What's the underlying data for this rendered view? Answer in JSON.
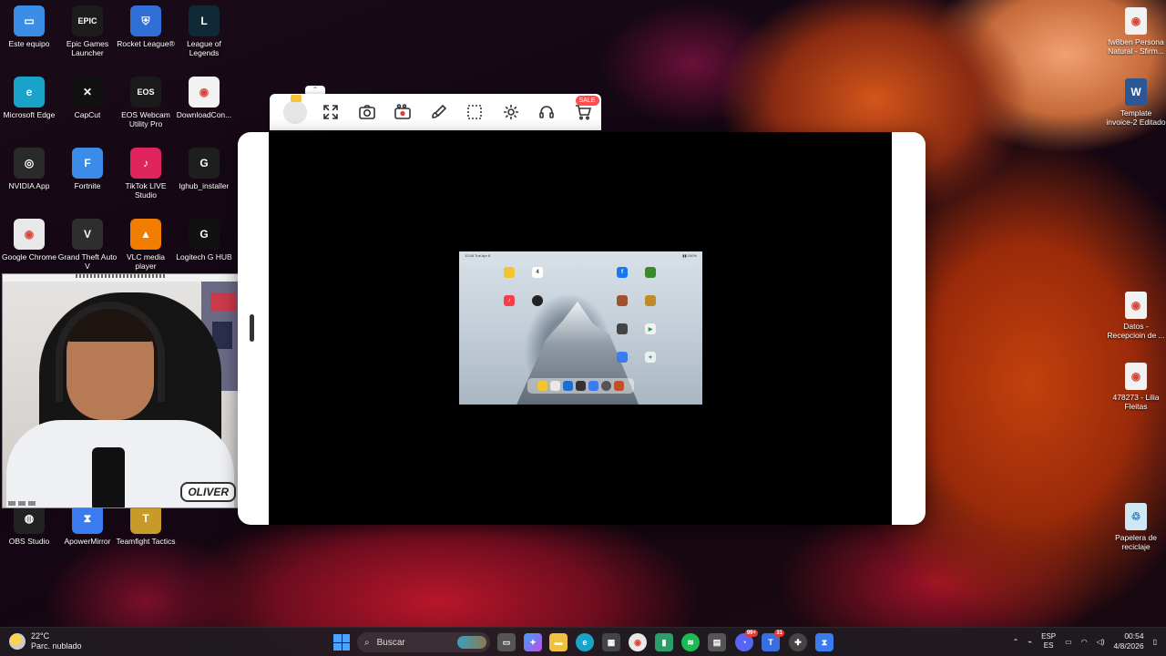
{
  "desktop": {
    "icons": [
      {
        "label": "Este equipo",
        "icon": "monitor-icon",
        "color": "#3a8ee6",
        "glyph": "▭"
      },
      {
        "label": "Epic Games Launcher",
        "icon": "epic-games-icon",
        "color": "#1c1c1c",
        "glyph": "EPIC"
      },
      {
        "label": "Rocket League®",
        "icon": "rocket-league-icon",
        "color": "#2f6fd6",
        "glyph": "⛨"
      },
      {
        "label": "League of Legends",
        "icon": "league-of-legends-icon",
        "color": "#0f2a36",
        "glyph": "L"
      },
      {
        "label": "Microsoft Edge",
        "icon": "edge-icon",
        "color": "#1aa3c9",
        "glyph": "e"
      },
      {
        "label": "CapCut",
        "icon": "capcut-icon",
        "color": "#111111",
        "glyph": "✕"
      },
      {
        "label": "EOS Webcam Utility Pro",
        "icon": "eos-webcam-icon",
        "color": "#1a1a1a",
        "glyph": "EOS"
      },
      {
        "label": "DownloadCon...",
        "icon": "chrome-file-icon",
        "color": "#f2f2f2",
        "glyph": "◉"
      },
      {
        "label": "NVIDIA App",
        "icon": "nvidia-icon",
        "color": "#2a2a2a",
        "glyph": "◎"
      },
      {
        "label": "Fortnite",
        "icon": "fortnite-icon",
        "color": "#3a8ce8",
        "glyph": "F"
      },
      {
        "label": "TikTok LIVE Studio",
        "icon": "tiktok-icon",
        "color": "#e0245e",
        "glyph": "♪"
      },
      {
        "label": "lghub_installer",
        "icon": "logitech-icon",
        "color": "#1e1e1e",
        "glyph": "G"
      },
      {
        "label": "Google Chrome",
        "icon": "chrome-icon",
        "color": "#e8e8e8",
        "glyph": "◉"
      },
      {
        "label": "Grand Theft Auto V",
        "icon": "gta-icon",
        "color": "#2e2e2e",
        "glyph": "V"
      },
      {
        "label": "VLC media player",
        "icon": "vlc-icon",
        "color": "#f07d00",
        "glyph": "▲"
      },
      {
        "label": "Logitech G HUB",
        "icon": "logitech-ghub-icon",
        "color": "#111111",
        "glyph": "G"
      },
      {
        "label": "OBS Studio",
        "icon": "obs-icon",
        "color": "#222222",
        "glyph": "◍"
      },
      {
        "label": "ApowerMirror",
        "icon": "apowermirror-icon",
        "color": "#3a7bf0",
        "glyph": "⧗"
      },
      {
        "label": "Teamfight Tactics",
        "icon": "tft-icon",
        "color": "#c79a2a",
        "glyph": "T"
      }
    ],
    "right_icons": [
      {
        "label": "fw8ben Persona Natural - Sfirm...",
        "icon": "chrome-file-icon"
      },
      {
        "label": "Template invoice-2 Editado",
        "icon": "word-file-icon"
      },
      {
        "label": "Datos - Recepcioin de ...",
        "icon": "chrome-file-icon"
      },
      {
        "label": "478273 - Lilia Fleitas",
        "icon": "chrome-file-icon"
      },
      {
        "label": "Papelera de reciclaje",
        "icon": "recycle-bin-icon"
      }
    ]
  },
  "webcam": {
    "name_tag": "OLIVER"
  },
  "mirror_app": {
    "sale_badge": "SALE",
    "toolbar_icons": [
      "expand-icon",
      "screenshot-icon",
      "record-icon",
      "brush-icon",
      "crop-icon",
      "settings-icon",
      "support-icon",
      "cart-icon"
    ],
    "tablet": {
      "status_left": "12:08  Tue Apr 8",
      "status_right": "▮▮ 100%",
      "calendar_day": "4"
    }
  },
  "taskbar": {
    "weather_temp": "22°C",
    "weather_desc": "Parc. nublado",
    "search_placeholder": "Buscar",
    "lang_top": "ESP",
    "lang_bottom": "ES",
    "time": "00:54",
    "date": "4/8/2026",
    "discord_badge": "99+",
    "teams_badge": "31",
    "colors": {
      "accent": "#4aa3ff"
    }
  }
}
